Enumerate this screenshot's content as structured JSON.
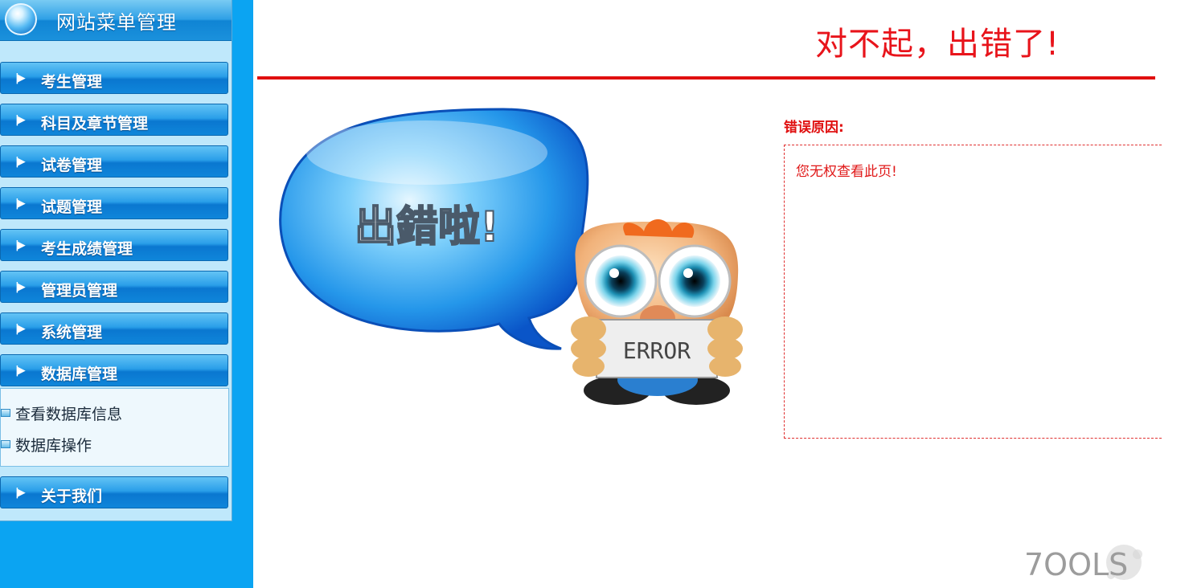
{
  "sidebar": {
    "title": "网站菜单管理",
    "items": [
      {
        "label": "考生管理"
      },
      {
        "label": "科目及章节管理"
      },
      {
        "label": "试卷管理"
      },
      {
        "label": "试题管理"
      },
      {
        "label": "考生成绩管理"
      },
      {
        "label": "管理员管理"
      },
      {
        "label": "系统管理"
      },
      {
        "label": "数据库管理"
      },
      {
        "label": "关于我们"
      }
    ],
    "submenu": [
      {
        "label": "查看数据库信息"
      },
      {
        "label": "数据库操作"
      }
    ]
  },
  "main": {
    "title": "对不起，出错了!",
    "illustration": {
      "bubble_text": "出錯啦!",
      "sign_text": "ERROR"
    },
    "reason_label": "错误原因:",
    "reason_message": "您无权查看此页!"
  },
  "watermark": {
    "text": "7OOLS"
  },
  "colors": {
    "sidebar_bg": "#0ba4f2",
    "menu_button": "#0a77d0",
    "error_red": "#e01010"
  }
}
